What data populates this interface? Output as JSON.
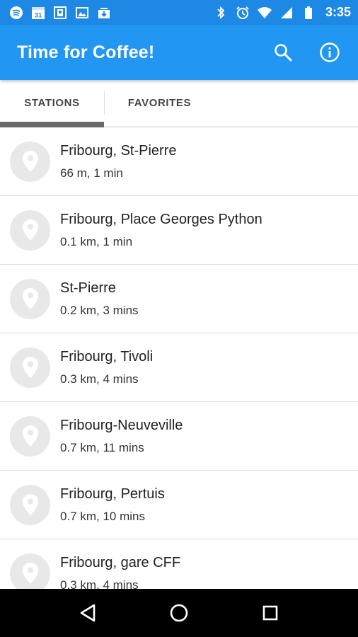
{
  "status_bar": {
    "time": "3:35",
    "calendar_day": "31",
    "icons": [
      "spotify-icon",
      "calendar-icon",
      "photo-frame-icon",
      "gallery-icon",
      "download-icon",
      "bluetooth-icon",
      "alarm-icon",
      "wifi-icon",
      "signal-icon",
      "battery-icon"
    ]
  },
  "app_bar": {
    "title": "Time for Coffee!",
    "actions": [
      "search-icon",
      "info-icon"
    ]
  },
  "tabs": [
    {
      "label": "STATIONS",
      "active": true
    },
    {
      "label": "FAVORITES",
      "active": false
    }
  ],
  "stations": [
    {
      "name": "Fribourg, St-Pierre",
      "distance": "66 m, 1 min"
    },
    {
      "name": "Fribourg, Place Georges Python",
      "distance": "0.1 km, 1 min"
    },
    {
      "name": "St-Pierre",
      "distance": "0.2 km, 3 mins"
    },
    {
      "name": "Fribourg, Tivoli",
      "distance": "0.3 km, 4 mins"
    },
    {
      "name": "Fribourg-Neuveville",
      "distance": "0.7 km, 11 mins"
    },
    {
      "name": "Fribourg, Pertuis",
      "distance": "0.7 km, 10 mins"
    },
    {
      "name": "Fribourg, gare CFF",
      "distance": "0.3 km, 4 mins"
    }
  ],
  "nav_bar": [
    "back-icon",
    "home-icon",
    "recents-icon"
  ],
  "colors": {
    "status_bar": "#1e88e5",
    "app_bar": "#2196f3",
    "tab_indicator": "#6a6a6a",
    "avatar_bg": "#e8e8e8"
  }
}
